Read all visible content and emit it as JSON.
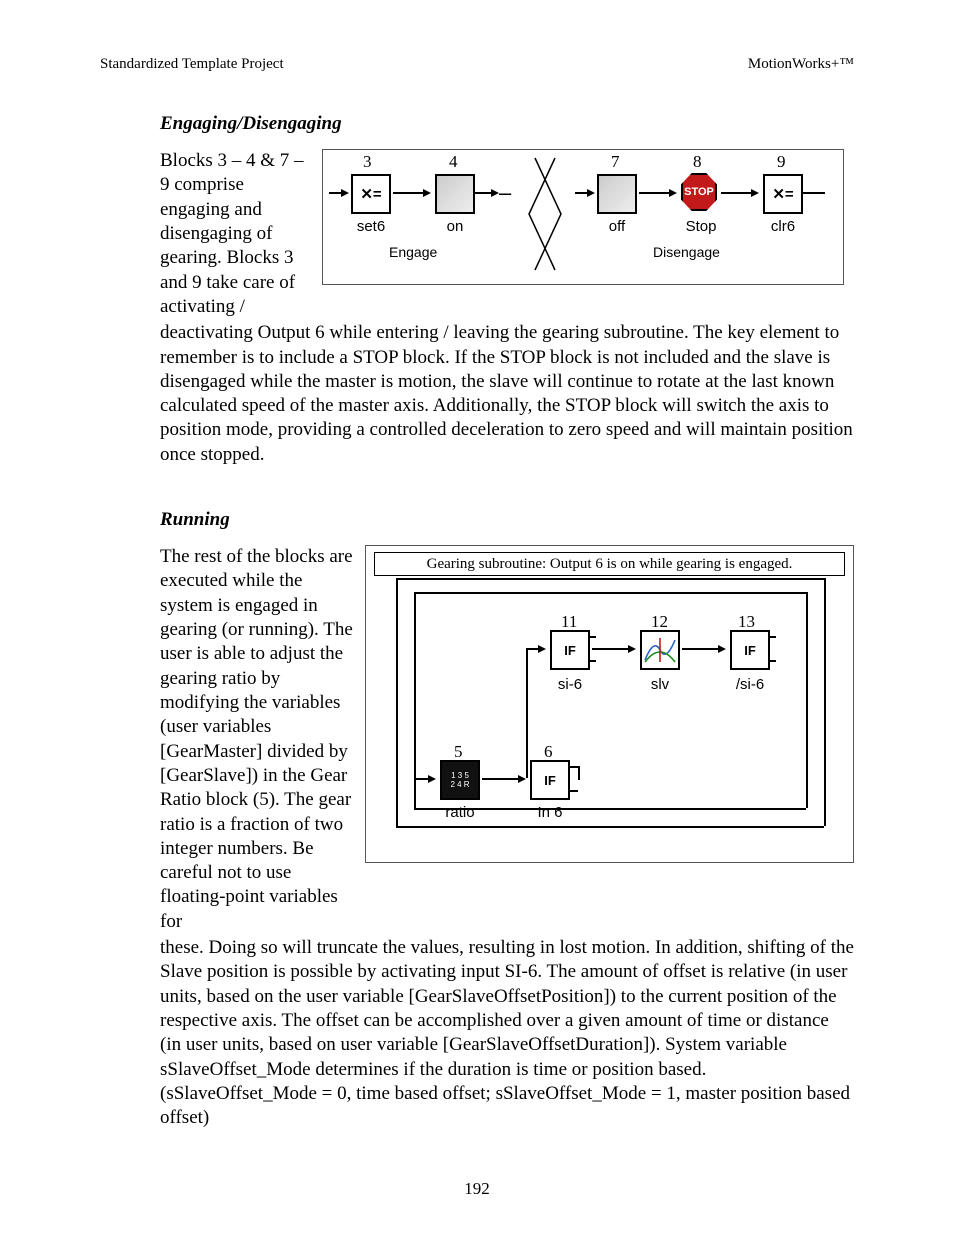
{
  "header": {
    "left": "Standardized Template Project",
    "right": "MotionWorks+™"
  },
  "section1": {
    "heading": "Engaging/Disengaging",
    "side_text": "Blocks 3 – 4 & 7 – 9 comprise engaging and disengaging of gearing.  Blocks 3 and 9 take care of activating /",
    "body": "deactivating Output 6 while entering / leaving the gearing subroutine. The key element to remember is to include a STOP block.  If the STOP block is not included and the slave is disengaged while the master is motion, the slave will continue to rotate at the last known calculated speed of the master axis.  Additionally, the STOP block will switch the axis to position mode, providing a controlled deceleration to zero speed and will maintain position once stopped."
  },
  "fig1": {
    "nums": {
      "n3": "3",
      "n4": "4",
      "n7": "7",
      "n8": "8",
      "n9": "9"
    },
    "caps": {
      "set6": "set6",
      "on": "on",
      "off": "off",
      "stop": "Stop",
      "clr6": "clr6"
    },
    "groups": {
      "engage": "Engage",
      "disengage": "Disengage"
    },
    "stop_label": "STOP",
    "xeq": "✕=",
    "dash": "–"
  },
  "section2": {
    "heading": "Running",
    "side_text": "The rest of the blocks are executed while the system is engaged in gearing (or running).  The user is able to adjust the gearing ratio by modifying the variables (user variables [GearMaster] divided by [GearSlave]) in the Gear Ratio block (5).  The gear ratio is a fraction of two integer numbers.  Be careful not to use floating-point variables for",
    "body": "these.  Doing so will truncate the values, resulting in lost motion.  In addition, shifting of the Slave position is possible by activating input SI-6.  The amount of offset is relative (in user units, based on the user variable [GearSlaveOffsetPosition]) to the current position of the respective axis.  The offset can be accomplished over a given amount of time or distance (in user units, based on user variable [GearSlaveOffsetDuration]).  System variable sSlaveOffset_Mode determines if the duration is time or position based.\n(sSlaveOffset_Mode = 0, time based offset; sSlaveOffset_Mode = 1, master position based offset)"
  },
  "fig2": {
    "title": "Gearing subroutine:  Output 6 is on while gearing is engaged.",
    "nums": {
      "n5": "5",
      "n6": "6",
      "n11": "11",
      "n12": "12",
      "n13": "13"
    },
    "caps": {
      "ratio": "ratio",
      "in6": "In 6",
      "si6": "si-6",
      "slv": "slv",
      "nsi6": "/si-6"
    },
    "if_label": "IF"
  },
  "page_number": "192"
}
